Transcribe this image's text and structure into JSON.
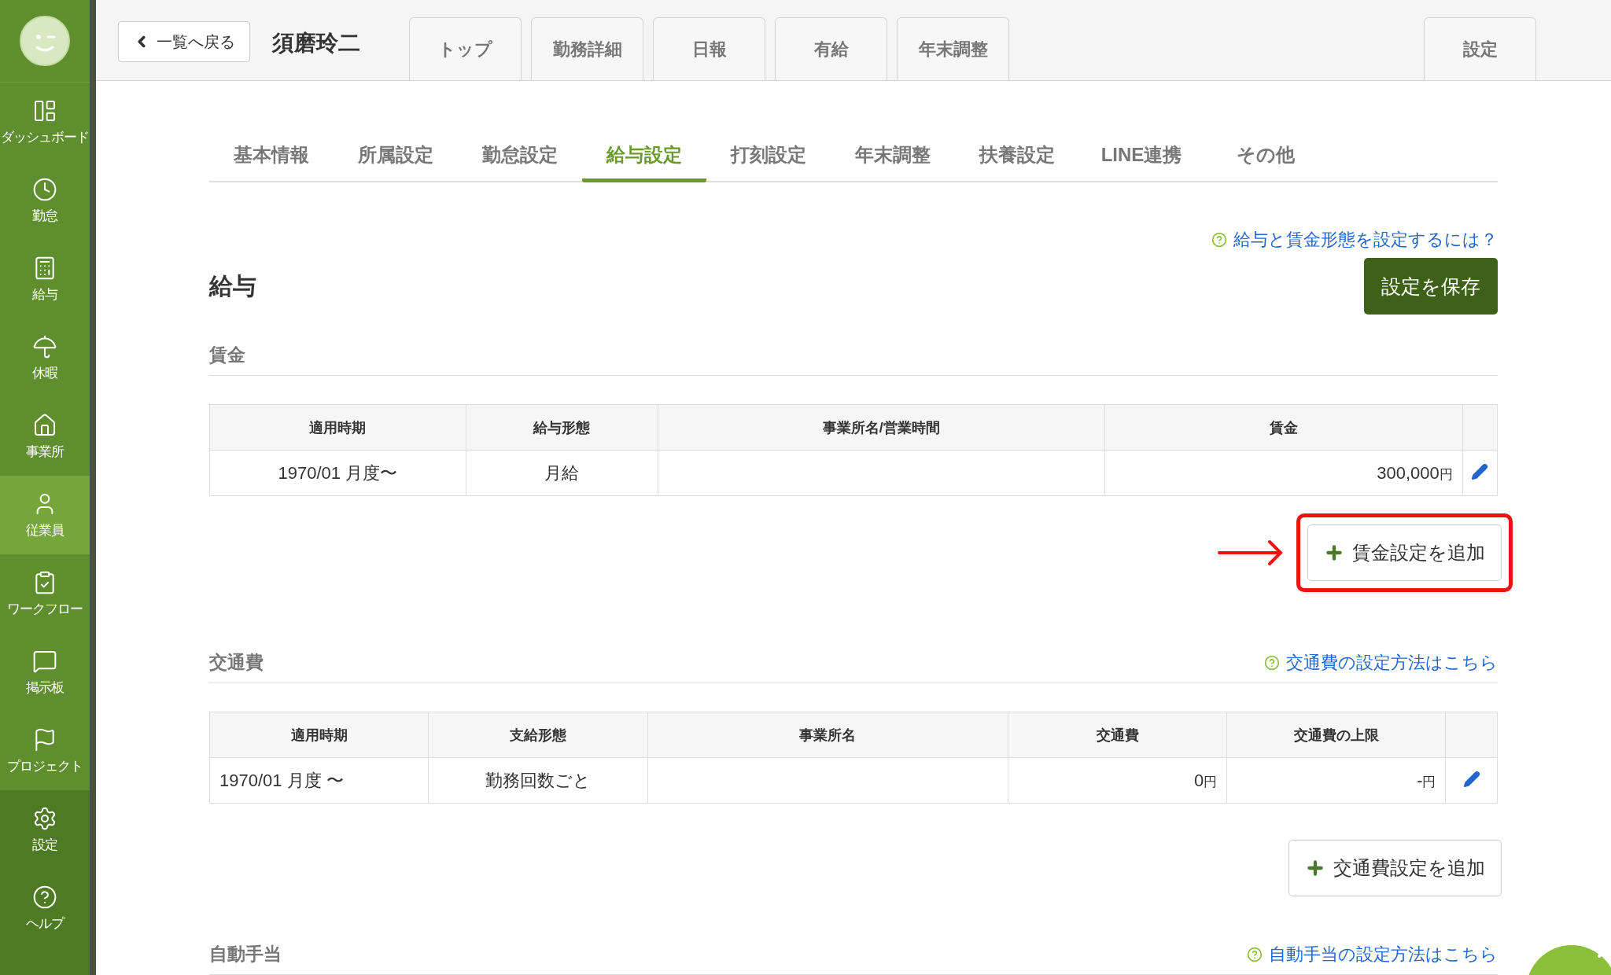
{
  "sidebar": {
    "items": [
      {
        "label": "ダッシュボード",
        "selected": false
      },
      {
        "label": "勤怠",
        "selected": false
      },
      {
        "label": "給与",
        "selected": false
      },
      {
        "label": "休暇",
        "selected": false
      },
      {
        "label": "事業所",
        "selected": false
      },
      {
        "label": "従業員",
        "selected": true
      },
      {
        "label": "ワークフロー",
        "selected": false
      },
      {
        "label": "掲示板",
        "selected": false
      },
      {
        "label": "プロジェクト",
        "selected": false
      }
    ],
    "bottom_items": [
      {
        "label": "設定"
      },
      {
        "label": "ヘルプ"
      }
    ]
  },
  "header": {
    "back_button": "一覧へ戻る",
    "employee_name": "須磨玲二",
    "tabs": [
      "トップ",
      "勤務詳細",
      "日報",
      "有給",
      "年末調整"
    ],
    "settings_tab": "設定"
  },
  "subtabs": [
    {
      "label": "基本情報",
      "selected": false
    },
    {
      "label": "所属設定",
      "selected": false
    },
    {
      "label": "勤怠設定",
      "selected": false
    },
    {
      "label": "給与設定",
      "selected": true
    },
    {
      "label": "打刻設定",
      "selected": false
    },
    {
      "label": "年末調整",
      "selected": false
    },
    {
      "label": "扶養設定",
      "selected": false
    },
    {
      "label": "LINE連携",
      "selected": false
    },
    {
      "label": "その他",
      "selected": false
    }
  ],
  "help_link": "給与と賃金形態を設定するには？",
  "page_title": "給与",
  "save_button": "設定を保存",
  "sections": [
    {
      "heading": "賃金",
      "columns": [
        "適用時期",
        "給与形態",
        "事業所名/営業時間",
        "賃金"
      ],
      "rows": [
        [
          {
            "text": "1970/01 月度〜"
          },
          {
            "text": "月給"
          },
          {},
          {
            "text": "300,000",
            "unit": "円"
          }
        ]
      ],
      "add_button": {
        "label": "賃金設定を追加",
        "highlighted": true
      }
    },
    {
      "heading": "交通費",
      "help_link": "交通費の設定方法はこちら",
      "columns": [
        "適用時期",
        "支給形態",
        "事業所名",
        "交通費",
        "交通費の上限"
      ],
      "rows": [
        [
          {
            "text": "1970/01 月度 〜"
          },
          {
            "text": "勤務回数ごと"
          },
          {},
          {
            "text": "0",
            "unit": "円"
          },
          {
            "text": "-",
            "unit": "円"
          }
        ]
      ],
      "add_button": {
        "label": "交通費設定を追加",
        "highlighted": false
      }
    },
    {
      "heading": "自動手当",
      "help_link": "自動手当の設定方法はこちら"
    }
  ]
}
